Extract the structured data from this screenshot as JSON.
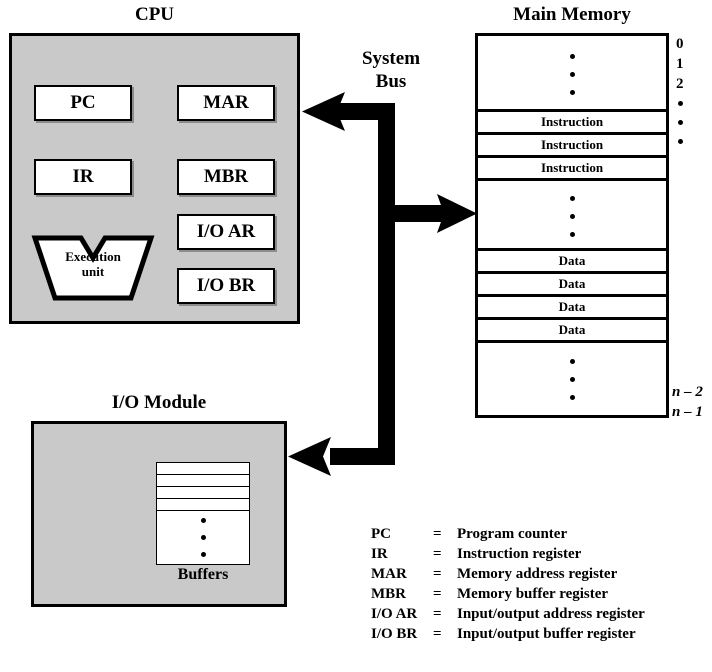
{
  "titles": {
    "cpu": "CPU",
    "memory": "Main Memory",
    "io": "I/O Module"
  },
  "bus": {
    "label_line1": "System",
    "label_line2": "Bus"
  },
  "cpu": {
    "registers": [
      {
        "name": "PC",
        "label": "PC"
      },
      {
        "name": "MAR",
        "label": "MAR"
      },
      {
        "name": "IR",
        "label": "IR"
      },
      {
        "name": "MBR",
        "label": "MBR"
      },
      {
        "name": "IOAR",
        "label": "I/O AR"
      },
      {
        "name": "IOBR",
        "label": "I/O BR"
      }
    ],
    "execution_unit": {
      "line1": "Execution",
      "line2": "unit"
    }
  },
  "memory": {
    "cells": [
      {
        "type": "dots",
        "label": ""
      },
      {
        "type": "value",
        "label": "Instruction"
      },
      {
        "type": "value",
        "label": "Instruction"
      },
      {
        "type": "value",
        "label": "Instruction"
      },
      {
        "type": "dots",
        "label": ""
      },
      {
        "type": "value",
        "label": "Data"
      },
      {
        "type": "value",
        "label": "Data"
      },
      {
        "type": "value",
        "label": "Data"
      },
      {
        "type": "value",
        "label": "Data"
      },
      {
        "type": "dots",
        "label": ""
      }
    ],
    "addresses_top": [
      "0",
      "1",
      "2"
    ],
    "addresses_bottom": [
      "n – 2",
      "n – 1"
    ]
  },
  "io": {
    "buffers_label": "Buffers"
  },
  "legend": {
    "rows": [
      {
        "abbr": "PC",
        "eq": "=",
        "desc": "Program counter"
      },
      {
        "abbr": "IR",
        "eq": "=",
        "desc": "Instruction register"
      },
      {
        "abbr": "MAR",
        "eq": "=",
        "desc": "Memory address register"
      },
      {
        "abbr": "MBR",
        "eq": "=",
        "desc": "Memory buffer register"
      },
      {
        "abbr": "I/O AR",
        "eq": "=",
        "desc": "Input/output address register"
      },
      {
        "abbr": "I/O BR",
        "eq": "=",
        "desc": "Input/output buffer register"
      }
    ]
  },
  "colors": {
    "module_fill": "#c9c9c9",
    "stroke": "#000000",
    "cell_fill": "#ffffff",
    "page_bg": "#ffffff"
  }
}
